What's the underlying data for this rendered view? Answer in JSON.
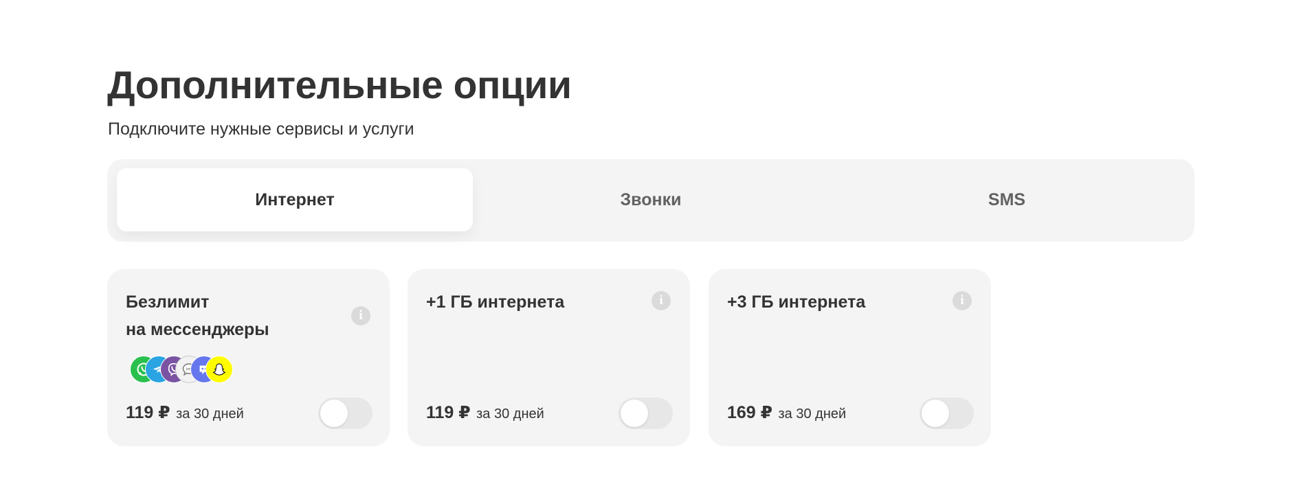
{
  "header": {
    "title": "Дополнительные опции",
    "subtitle": "Подключите нужные сервисы и услуги"
  },
  "tabs": [
    {
      "label": "Интернет",
      "active": true
    },
    {
      "label": "Звонки",
      "active": false
    },
    {
      "label": "SMS",
      "active": false
    }
  ],
  "cards": [
    {
      "title_line1": "Безлимит",
      "title_line2": "на мессенджеры",
      "price": "119 ₽",
      "period": "за 30 дней",
      "enabled": false,
      "messenger_icons": [
        "whatsapp-icon",
        "telegram-icon",
        "viber-icon",
        "imessage-icon",
        "discord-icon",
        "snapchat-icon"
      ]
    },
    {
      "title_line1": "+1 ГБ интернета",
      "title_line2": "",
      "price": "119 ₽",
      "period": "за 30 дней",
      "enabled": false
    },
    {
      "title_line1": "+3 ГБ интернета",
      "title_line2": "",
      "price": "169 ₽",
      "period": "за 30 дней",
      "enabled": false
    }
  ],
  "colors": {
    "text": "#333333",
    "card_bg": "#f4f4f4",
    "toggle_off": "#e7e7e7",
    "whatsapp": "#29c04e",
    "telegram": "#2aa4e2",
    "viber": "#7a53a3",
    "imessage": "#f2f2f2",
    "discord": "#6677ee",
    "snapchat": "#fffc00"
  }
}
